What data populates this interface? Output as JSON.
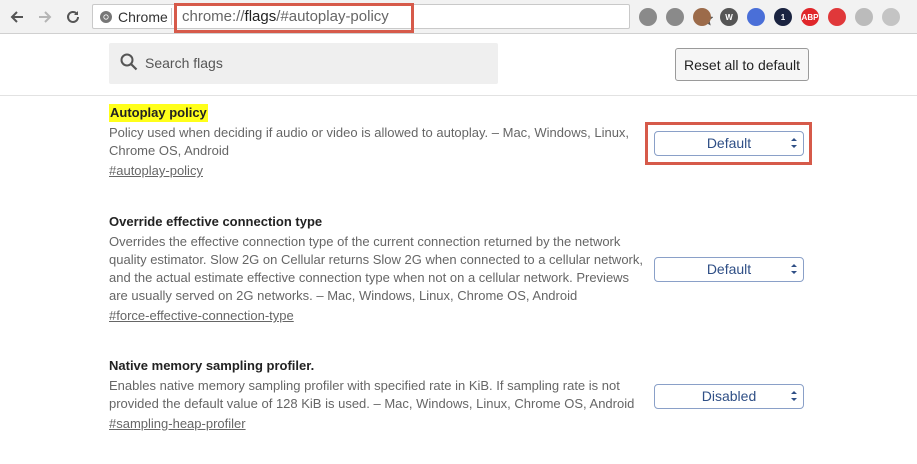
{
  "browser": {
    "chip_label": "Chrome",
    "url_prefix": "chrome://",
    "url_host": "flags",
    "url_rest": "/#autoplay-policy",
    "extensions": [
      {
        "name": "vimeo-ext-icon",
        "color": "#8a8a8a",
        "text": ""
      },
      {
        "name": "pocket-ext-icon",
        "color": "#8a8a8a",
        "text": ""
      },
      {
        "name": "avatar-ext-icon",
        "color": "#9c6b4a",
        "text": ""
      },
      {
        "name": "w-ext-icon",
        "color": "#555555",
        "text": "W"
      },
      {
        "name": "circle-ext-icon",
        "color": "#4a6fd8",
        "text": ""
      },
      {
        "name": "onepassword-ext-icon",
        "color": "#1a2340",
        "text": "1"
      },
      {
        "name": "abp-ext-icon",
        "color": "#e0262a",
        "text": "ABP"
      },
      {
        "name": "red-ext-icon",
        "color": "#e0383a",
        "text": ""
      },
      {
        "name": "play-ext-icon",
        "color": "#bbbbbb",
        "text": ""
      },
      {
        "name": "gray-ext-icon",
        "color": "#c4c4c4",
        "text": ""
      }
    ]
  },
  "search": {
    "placeholder": "Search flags",
    "value": ""
  },
  "reset_label": "Reset all to default",
  "experiments": [
    {
      "title": "Autoplay policy",
      "description": "Policy used when deciding if audio or video is allowed to autoplay. – Mac, Windows, Linux, Chrome OS, Android",
      "link": "#autoplay-policy",
      "selected": "Default"
    },
    {
      "title": "Override effective connection type",
      "description": "Overrides the effective connection type of the current connection returned by the network quality estimator. Slow 2G on Cellular returns Slow 2G when connected to a cellular network, and the actual estimate effective connection type when not on a cellular network. Previews are usually served on 2G networks. – Mac, Windows, Linux, Chrome OS, Android",
      "link": "#force-effective-connection-type",
      "selected": "Default"
    },
    {
      "title": "Native memory sampling profiler.",
      "description": "Enables native memory sampling profiler with specified rate in KiB. If sampling rate is not provided the default value of 128 KiB is used. – Mac, Windows, Linux, Chrome OS, Android",
      "link": "#sampling-heap-profiler",
      "selected": "Disabled"
    }
  ]
}
